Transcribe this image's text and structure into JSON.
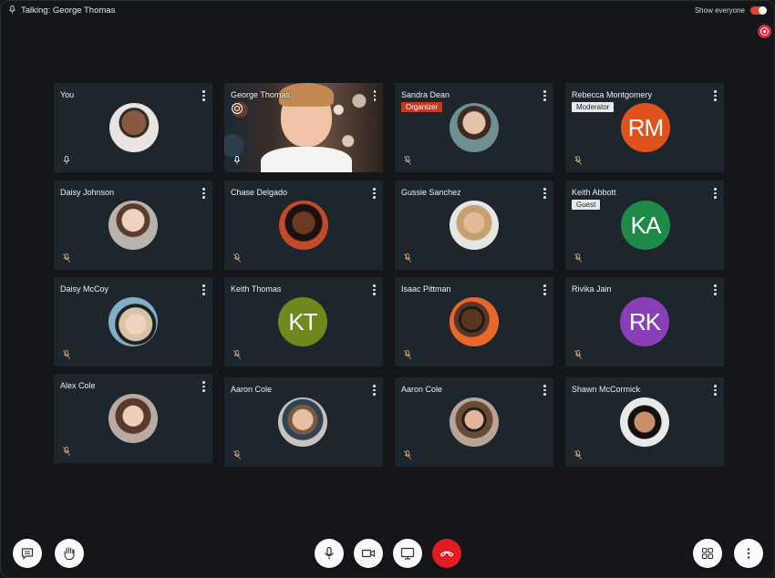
{
  "topbar": {
    "talking_label": "Talking: George Thomas",
    "show_everyone_label": "Show everyone",
    "show_everyone_on": true
  },
  "colors": {
    "background": "#14161a",
    "tile": "#1e262d",
    "organizer_badge": "#c23a20",
    "end_call": "#e01b22",
    "record": "#e2233f"
  },
  "participants": [
    {
      "name": "You",
      "avatar": "photo",
      "mic": "on"
    },
    {
      "name": "George Thomas",
      "avatar": "video",
      "mic": "on",
      "speaking": true
    },
    {
      "name": "Sandra Dean",
      "badge": "Organizer",
      "avatar": "photo",
      "mic": "muted"
    },
    {
      "name": "Rebecca Montgomery",
      "badge": "Moderator",
      "initials": "RM",
      "color": "#e0521c",
      "mic": "muted"
    },
    {
      "name": "Daisy Johnson",
      "avatar": "photo",
      "mic": "muted"
    },
    {
      "name": "Chase Delgado",
      "avatar": "photo",
      "mic": "muted"
    },
    {
      "name": "Gussie Sanchez",
      "avatar": "photo",
      "mic": "muted"
    },
    {
      "name": "Keith Abbott",
      "badge": "Guest",
      "initials": "KA",
      "color": "#1f8a47",
      "mic": "muted"
    },
    {
      "name": "Daisy McCoy",
      "avatar": "photo",
      "mic": "muted"
    },
    {
      "name": "Keith Thomas",
      "initials": "KT",
      "color": "#6e8a1e",
      "mic": "muted"
    },
    {
      "name": "Isaac Pittman",
      "avatar": "photo",
      "mic": "muted"
    },
    {
      "name": "Rivika Jain",
      "initials": "RK",
      "color": "#8a3fb8",
      "mic": "muted"
    },
    {
      "name": "Alex Cole",
      "avatar": "photo",
      "mic": "muted"
    },
    {
      "name": "Aaron Cole",
      "avatar": "photo",
      "mic": "muted"
    },
    {
      "name": "Aaron Cole",
      "avatar": "photo",
      "mic": "muted"
    },
    {
      "name": "Shawn McCormick",
      "avatar": "photo",
      "mic": "muted"
    }
  ],
  "controls": {
    "left": [
      "chat-icon",
      "raise-hand-icon"
    ],
    "center": [
      "microphone-icon",
      "camera-icon",
      "screen-share-icon",
      "end-call-icon"
    ],
    "right": [
      "grid-layout-icon",
      "more-options-icon"
    ]
  }
}
